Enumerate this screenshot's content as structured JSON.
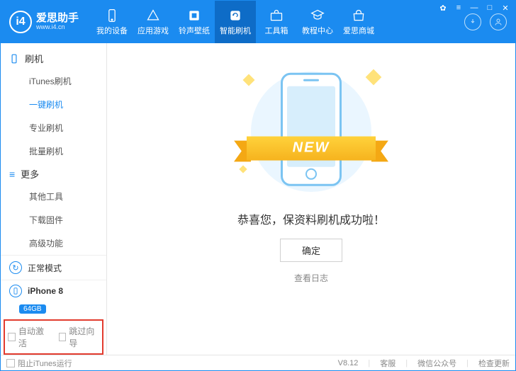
{
  "app": {
    "title": "爱思助手",
    "url": "www.i4.cn"
  },
  "nav": [
    {
      "label": "我的设备"
    },
    {
      "label": "应用游戏"
    },
    {
      "label": "铃声壁纸"
    },
    {
      "label": "智能刷机"
    },
    {
      "label": "工具箱"
    },
    {
      "label": "教程中心"
    },
    {
      "label": "爱思商城"
    }
  ],
  "sidebar": {
    "group1": {
      "title": "刷机",
      "items": [
        "iTunes刷机",
        "一键刷机",
        "专业刷机",
        "批量刷机"
      ]
    },
    "group2": {
      "title": "更多",
      "items": [
        "其他工具",
        "下载固件",
        "高级功能"
      ]
    }
  },
  "mode": {
    "label": "正常模式"
  },
  "device": {
    "name": "iPhone 8",
    "storage": "64GB"
  },
  "options": {
    "auto_activate": "自动激活",
    "skip_guide": "跳过向导"
  },
  "main": {
    "ribbon": "NEW",
    "success": "恭喜您，保资料刷机成功啦！",
    "ok": "确定",
    "view_log": "查看日志"
  },
  "footer": {
    "block_itunes": "阻止iTunes运行",
    "version": "V8.12",
    "support": "客服",
    "wechat": "微信公众号",
    "update": "检查更新"
  }
}
